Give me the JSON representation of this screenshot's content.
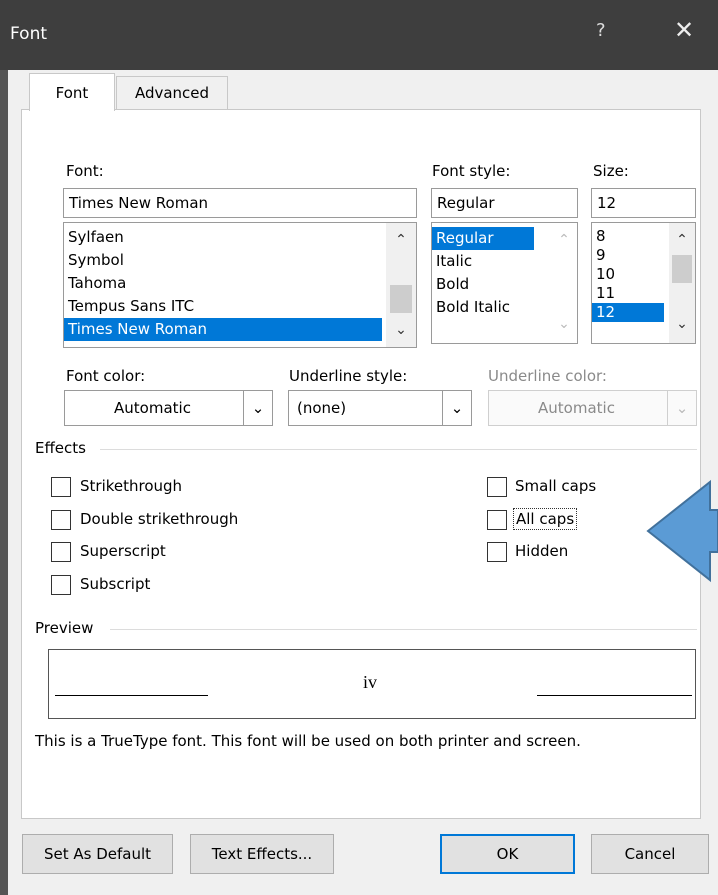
{
  "window": {
    "title": "Font",
    "help": "?",
    "close": "✕"
  },
  "tabs": [
    {
      "label": "Font"
    },
    {
      "label": "Advanced"
    }
  ],
  "font": {
    "label": "Font:",
    "value": "Times New Roman",
    "list": [
      "Sylfaen",
      "Symbol",
      "Tahoma",
      "Tempus Sans ITC",
      "Times New Roman"
    ],
    "selected": "Times New Roman"
  },
  "style": {
    "label": "Font style:",
    "value": "Regular",
    "list": [
      "Regular",
      "Italic",
      "Bold",
      "Bold Italic"
    ],
    "selected": "Regular"
  },
  "size": {
    "label": "Size:",
    "value": "12",
    "list": [
      "8",
      "9",
      "10",
      "11",
      "12"
    ],
    "selected": "12"
  },
  "font_color": {
    "label": "Font color:",
    "value": "Automatic"
  },
  "underline_style": {
    "label": "Underline style:",
    "value": "(none)"
  },
  "underline_color": {
    "label": "Underline color:",
    "value": "Automatic"
  },
  "effects": {
    "label": "Effects",
    "left": [
      "Strikethrough",
      "Double strikethrough",
      "Superscript",
      "Subscript"
    ],
    "right": [
      "Small caps",
      "All caps",
      "Hidden"
    ]
  },
  "preview": {
    "label": "Preview",
    "sample": "iv",
    "note": "This is a TrueType font. This font will be used on both printer and screen."
  },
  "buttons": {
    "set_default": "Set As Default",
    "text_effects": "Text Effects...",
    "ok": "OK",
    "cancel": "Cancel"
  },
  "colors": {
    "selection": "#0078d7",
    "annotation_arrow": "#5b9bd5",
    "titlebar": "#3e3e3e"
  }
}
